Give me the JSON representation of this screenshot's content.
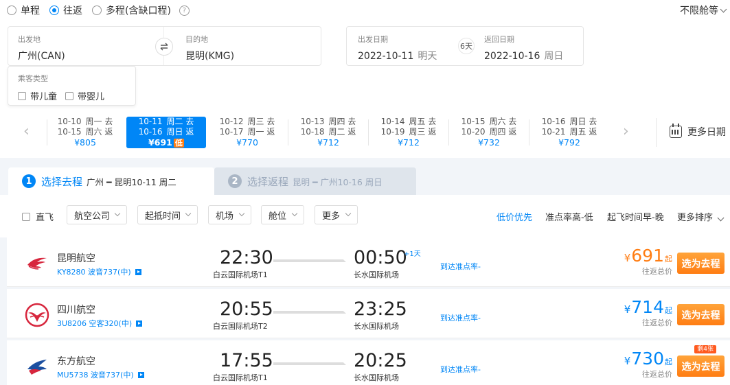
{
  "trip_types": [
    {
      "label": "单程",
      "selected": false
    },
    {
      "label": "往返",
      "selected": true
    },
    {
      "label": "多程(含缺口程)",
      "selected": false
    }
  ],
  "cabin": "不限舱等",
  "search": {
    "from_label": "出发地",
    "from_value": "广州(CAN)",
    "to_label": "目的地",
    "to_value": "昆明(KMG)",
    "depart_label": "出发日期",
    "depart_date": "2022-10-11",
    "depart_day": "明天",
    "return_label": "返回日期",
    "return_date": "2022-10-16",
    "return_day": "周日",
    "days_between": "6天"
  },
  "passenger": {
    "label": "乘客类型",
    "options": [
      "带儿童",
      "带婴儿"
    ]
  },
  "date_options": [
    {
      "go": "10-10",
      "go_day": "周一",
      "go_tag": "去",
      "back": "10-15",
      "back_day": "周六",
      "back_tag": "返",
      "price": "¥805"
    },
    {
      "go": "10-11",
      "go_day": "周二",
      "go_tag": "去",
      "back": "10-16",
      "back_day": "周日",
      "back_tag": "返",
      "price": "¥691",
      "low": "低"
    },
    {
      "go": "10-12",
      "go_day": "周三",
      "go_tag": "去",
      "back": "10-17",
      "back_day": "周一",
      "back_tag": "返",
      "price": "¥770"
    },
    {
      "go": "10-13",
      "go_day": "周四",
      "go_tag": "去",
      "back": "10-18",
      "back_day": "周二",
      "back_tag": "返",
      "price": "¥712"
    },
    {
      "go": "10-14",
      "go_day": "周五",
      "go_tag": "去",
      "back": "10-19",
      "back_day": "周三",
      "back_tag": "返",
      "price": "¥712"
    },
    {
      "go": "10-15",
      "go_day": "周六",
      "go_tag": "去",
      "back": "10-20",
      "back_day": "周四",
      "back_tag": "返",
      "price": "¥732"
    },
    {
      "go": "10-16",
      "go_day": "周日",
      "go_tag": "去",
      "back": "10-21",
      "back_day": "周五",
      "back_tag": "返",
      "price": "¥792"
    }
  ],
  "more_dates": "更多日期",
  "tabs": [
    {
      "num": "1",
      "title": "选择去程",
      "sub": "广州 ━ 昆明10-11 周二"
    },
    {
      "num": "2",
      "title": "选择返程",
      "sub": "昆明 ━ 广州10-16 周日"
    }
  ],
  "filters": {
    "direct": "直飞",
    "dropdowns": [
      "航空公司",
      "起抵时间",
      "机场",
      "舱位",
      "更多"
    ],
    "sorts": [
      "低价优先",
      "准点率高-低",
      "起飞时间早-晚",
      "更多排序"
    ]
  },
  "flights": [
    {
      "airline": "昆明航空",
      "flight_no": "KY8280 波音737(中)",
      "dep_time": "22:30",
      "dep_airport": "白云国际机场T1",
      "arr_time": "00:50",
      "arr_airport": "长水国际机场",
      "plus_day": "+1天",
      "ontime": "到达准点率-",
      "yen": "¥",
      "price": "691",
      "qi": "起",
      "total": "往返总价",
      "button": "选为去程"
    },
    {
      "airline": "四川航空",
      "flight_no": "3U8206 空客320(中)",
      "dep_time": "20:55",
      "dep_airport": "白云国际机场T2",
      "arr_time": "23:25",
      "arr_airport": "长水国际机场",
      "ontime": "到达准点率-",
      "yen": "¥",
      "price": "714",
      "qi": "起",
      "total": "往返总价",
      "button": "选为去程"
    },
    {
      "airline": "东方航空",
      "flight_no": "MU5738 波音737(中)",
      "dep_time": "17:55",
      "dep_airport": "白云国际机场T1",
      "arr_time": "20:25",
      "arr_airport": "长水国际机场",
      "ontime": "到达准点率-",
      "yen": "¥",
      "price": "730",
      "qi": "起",
      "total": "往返总价",
      "button": "选为去程",
      "badge": "剩4张"
    }
  ],
  "colors": {
    "accent": "#0086f6",
    "orange": "#ff7d13"
  }
}
